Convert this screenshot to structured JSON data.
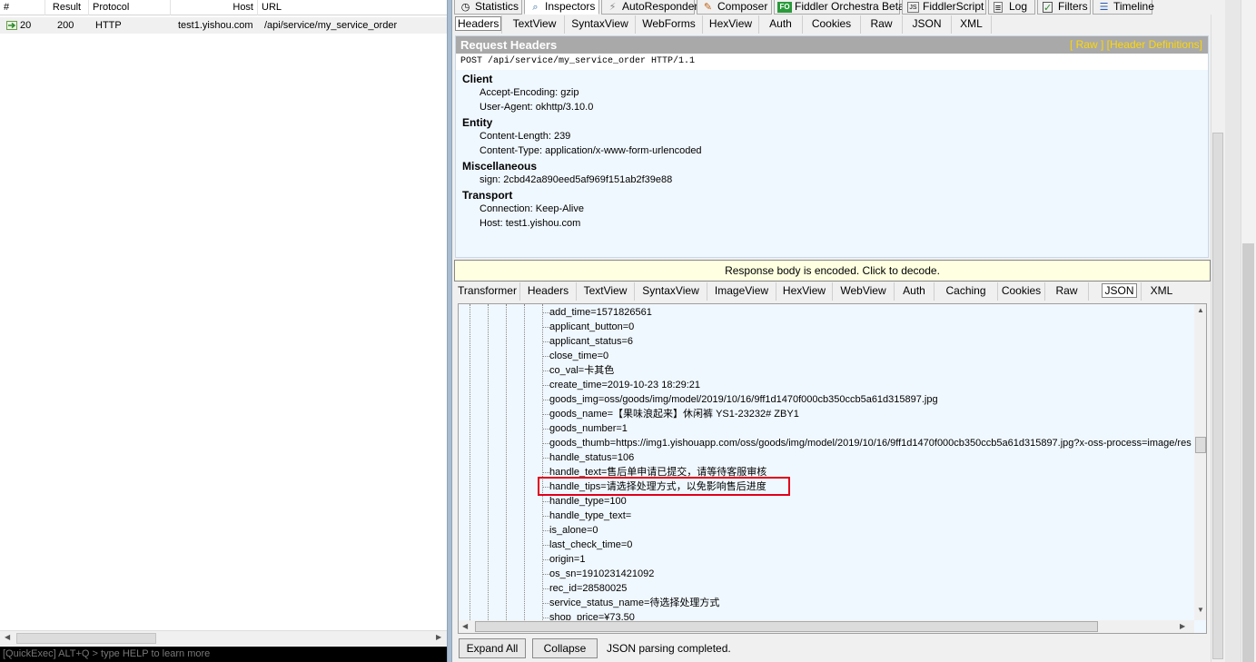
{
  "session_list": {
    "columns": [
      "#",
      "Result",
      "Protocol",
      "Host",
      "URL"
    ],
    "rows": [
      {
        "num": "20",
        "result": "200",
        "protocol": "HTTP",
        "host": "test1.yishou.com",
        "url": "/api/service/my_service_order"
      }
    ]
  },
  "quickexec": {
    "placeholder": "[QuickExec] ALT+Q > type HELP to learn more"
  },
  "main_tabs": [
    {
      "label": "Statistics",
      "icon": "stopwatch-icon"
    },
    {
      "label": "Inspectors",
      "icon": "inspector-icon"
    },
    {
      "label": "AutoResponder",
      "icon": "lightning-icon"
    },
    {
      "label": "Composer",
      "icon": "composer-icon"
    },
    {
      "label": "Fiddler Orchestra Beta",
      "icon": "fo-icon"
    },
    {
      "label": "FiddlerScript",
      "icon": "js-icon"
    },
    {
      "label": "Log",
      "icon": "log-icon"
    },
    {
      "label": "Filters",
      "icon": "checkbox-icon"
    },
    {
      "label": "Timeline",
      "icon": "timeline-icon"
    }
  ],
  "request_tabs": [
    "Headers",
    "TextView",
    "SyntaxView",
    "WebForms",
    "HexView",
    "Auth",
    "Cookies",
    "Raw",
    "JSON",
    "XML"
  ],
  "request_headers": {
    "title": "Request Headers",
    "links": "[ Raw ]   [Header Definitions]",
    "request_line": "POST /api/service/my_service_order HTTP/1.1",
    "groups": [
      {
        "name": "Client",
        "items": [
          "Accept-Encoding: gzip",
          "User-Agent: okhttp/3.10.0"
        ]
      },
      {
        "name": "Entity",
        "items": [
          "Content-Length: 239",
          "Content-Type: application/x-www-form-urlencoded"
        ]
      },
      {
        "name": "Miscellaneous",
        "items": [
          "sign: 2cbd42a890eed5af969f151ab2f39e88"
        ]
      },
      {
        "name": "Transport",
        "items": [
          "Connection: Keep-Alive",
          "Host: test1.yishou.com"
        ]
      }
    ]
  },
  "encode_notice": "Response body is encoded. Click to decode.",
  "response_tabs": [
    "Transformer",
    "Headers",
    "TextView",
    "SyntaxView",
    "ImageView",
    "HexView",
    "WebView",
    "Auth",
    "Caching",
    "Cookies",
    "Raw",
    "JSON",
    "XML"
  ],
  "json_lines": [
    "add_time=1571826561",
    "applicant_button=0",
    "applicant_status=6",
    "close_time=0",
    "co_val=卡其色",
    "create_time=2019-10-23 18:29:21",
    "goods_img=oss/goods/img/model/2019/10/16/9ff1d1470f000cb350ccb5a61d315897.jpg",
    "goods_name=【果味浪起来】休闲裤 YS1-23232# ZBY1",
    "goods_number=1",
    "goods_thumb=https://img1.yishouapp.com/oss/goods/img/model/2019/10/16/9ff1d1470f000cb350ccb5a61d315897.jpg?x-oss-process=image/res",
    "handle_status=106",
    "handle_text=售后单申请已提交，请等待客服审核",
    "handle_tips=请选择处理方式，以免影响售后进度",
    "handle_type=100",
    "handle_type_text=",
    "is_alone=0",
    "last_check_time=0",
    "origin=1",
    "os_sn=1910231421092",
    "rec_id=28580025",
    "service_status_name=待选择处理方式",
    "shop_price=¥73.50"
  ],
  "bottom": {
    "expand_all": "Expand All",
    "collapse": "Collapse",
    "status": "JSON parsing completed."
  }
}
